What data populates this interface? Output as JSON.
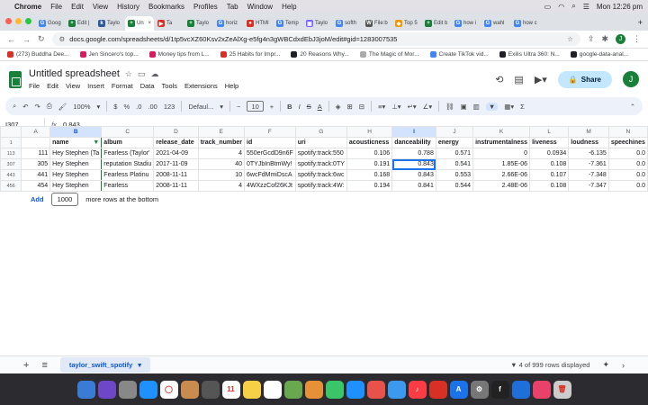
{
  "menubar": {
    "app": "Chrome",
    "items": [
      "File",
      "Edit",
      "View",
      "History",
      "Bookmarks",
      "Profiles",
      "Tab",
      "Window",
      "Help"
    ],
    "clock": "Mon 12:26 pm"
  },
  "tabs": [
    {
      "label": "Goog",
      "color": "#4285f4",
      "glyph": "G"
    },
    {
      "label": "Edit |",
      "color": "#188038",
      "glyph": "+"
    },
    {
      "label": "Taylo",
      "color": "#2d5a9a",
      "glyph": "k"
    },
    {
      "label": "Un",
      "color": "#188038",
      "glyph": "+",
      "active": true
    },
    {
      "label": "Ta",
      "color": "#d93025",
      "glyph": "▶"
    },
    {
      "label": "Taylo",
      "color": "#188038",
      "glyph": "+"
    },
    {
      "label": "horiz",
      "color": "#4285f4",
      "glyph": "G"
    },
    {
      "label": "HTMI",
      "color": "#d93025",
      "glyph": "●"
    },
    {
      "label": "Temp",
      "color": "#4285f4",
      "glyph": "G"
    },
    {
      "label": "Taylo",
      "color": "#7b61ff",
      "glyph": "▣"
    },
    {
      "label": "softh",
      "color": "#4285f4",
      "glyph": "G"
    },
    {
      "label": "File:b",
      "color": "#555",
      "glyph": "W"
    },
    {
      "label": "Top 5",
      "color": "#f29900",
      "glyph": "◆"
    },
    {
      "label": "Edit b",
      "color": "#188038",
      "glyph": "+"
    },
    {
      "label": "how i",
      "color": "#4285f4",
      "glyph": "G"
    },
    {
      "label": "wahl",
      "color": "#4285f4",
      "glyph": "G"
    },
    {
      "label": "how c",
      "color": "#4285f4",
      "glyph": "G"
    }
  ],
  "address": {
    "url": "docs.google.com/spreadsheets/d/1tp5vcXZ60Ksv2xZeAlXg-e5fg4n3gWBCdxdEbJ3joM/edit#gid=1283007535",
    "avatar": "J"
  },
  "bookmarks": [
    {
      "label": "(273) Buddha Dee...",
      "color": "#d93025"
    },
    {
      "label": "Jen Sincero's top...",
      "color": "#d81b60"
    },
    {
      "label": "Money tips from L...",
      "color": "#d81b60"
    },
    {
      "label": "25 Habits for Impr...",
      "color": "#d93025"
    },
    {
      "label": "20 Reasons Why...",
      "color": "#202124"
    },
    {
      "label": "The Magic of Mor...",
      "color": "#aaa"
    },
    {
      "label": "Create TikTok vid...",
      "color": "#4285f4"
    },
    {
      "label": "Exilis Ultra 360: N...",
      "color": "#202124"
    },
    {
      "label": "google-data-anal...",
      "color": "#202124"
    }
  ],
  "sheet": {
    "title": "Untitled spreadsheet",
    "menus": [
      "File",
      "Edit",
      "View",
      "Insert",
      "Format",
      "Data",
      "Tools",
      "Extensions",
      "Help"
    ],
    "share": "Share",
    "avatar": "J"
  },
  "toolbar": {
    "zoom": "100%",
    "currency": "$",
    "percent": "%",
    "dec_less": ".0",
    "dec_more": ".00",
    "format": "123",
    "font": "Defaul...",
    "minus": "−",
    "font_size": "10",
    "plus": "+",
    "bold": "B",
    "italic": "I",
    "strike": "S",
    "textcolor": "A"
  },
  "formula": {
    "cell": "I307",
    "fx": "fx",
    "value": "0.843"
  },
  "grid": {
    "columns": [
      "A",
      "B",
      "C",
      "D",
      "E",
      "F",
      "G",
      "H",
      "I",
      "J",
      "K",
      "L",
      "M",
      "N"
    ],
    "header_row": {
      "num": "1",
      "cells": [
        "",
        "name",
        "album",
        "release_date",
        "track_number",
        "id",
        "uri",
        "acousticness",
        "danceability",
        "energy",
        "instrumentalness",
        "liveness",
        "loudness",
        "speechines"
      ]
    },
    "rows": [
      {
        "num": "113",
        "cells": [
          "111",
          "Hey Stephen (Ta",
          "Fearless (Taylor'",
          "2021-04-09",
          "4",
          "550erGcdD9n6F",
          "spotify:track:550",
          "0.106",
          "0.788",
          "0.571",
          "0",
          "0.0934",
          "-6.135",
          "0.0"
        ]
      },
      {
        "num": "307",
        "cells": [
          "305",
          "Hey Stephen",
          "reputation Stadiu",
          "2017-11-09",
          "40",
          "0TYJbInBtmWy!",
          "spotify:track:0TY",
          "0.191",
          "0.843",
          "0.541",
          "1.85E-06",
          "0.108",
          "-7.361",
          "0.0"
        ]
      },
      {
        "num": "443",
        "cells": [
          "441",
          "Hey Stephen",
          "Fearless Platinu",
          "2008-11-11",
          "10",
          "6wcFdMmiDscA",
          "spotify:track:6wc",
          "0.168",
          "0.843",
          "0.553",
          "2.66E-06",
          "0.107",
          "-7.348",
          "0.0"
        ]
      },
      {
        "num": "456",
        "cells": [
          "454",
          "Hey Stephen",
          "Fearless",
          "2008-11-11",
          "4",
          "4WXzzCof26KJt",
          "spotify:track:4W:",
          "0.194",
          "0.841",
          "0.544",
          "2.48E-06",
          "0.108",
          "-7.347",
          "0.0"
        ]
      }
    ]
  },
  "footer": {
    "add": "Add",
    "rows_count": "1000",
    "more_rows": "more rows at the bottom",
    "plus": "+",
    "list": "≡",
    "sheet_tab": "taylor_swift_spotify",
    "tab_arrow": "▾",
    "status": "4 of 999 rows displayed"
  },
  "dock": [
    {
      "color": "#3a7bd5",
      "g": ""
    },
    {
      "color": "#6e47c9",
      "g": ""
    },
    {
      "color": "#888",
      "g": ""
    },
    {
      "color": "#1e90ff",
      "g": ""
    },
    {
      "color": "#fff",
      "g": "◯"
    },
    {
      "color": "#c98b4e",
      "g": ""
    },
    {
      "color": "#555",
      "g": ""
    },
    {
      "color": "#fff",
      "g": "11"
    },
    {
      "color": "#f7d046",
      "g": ""
    },
    {
      "color": "#fff",
      "g": ""
    },
    {
      "color": "#6aa84f",
      "g": ""
    },
    {
      "color": "#e69138",
      "g": ""
    },
    {
      "color": "#3ac569",
      "g": ""
    },
    {
      "color": "#1e90ff",
      "g": ""
    },
    {
      "color": "#e7534b",
      "g": ""
    },
    {
      "color": "#3b9af0",
      "g": ""
    },
    {
      "color": "#fc3c44",
      "g": "♪"
    },
    {
      "color": "#d93025",
      "g": ""
    },
    {
      "color": "#1a73e8",
      "g": "A"
    },
    {
      "color": "#777",
      "g": "⚙"
    },
    {
      "color": "#222",
      "g": "f"
    },
    {
      "color": "#1e6fd9",
      "g": ""
    },
    {
      "color": "#e8426b",
      "g": ""
    },
    {
      "color": "#ccc",
      "g": "🗑"
    }
  ]
}
